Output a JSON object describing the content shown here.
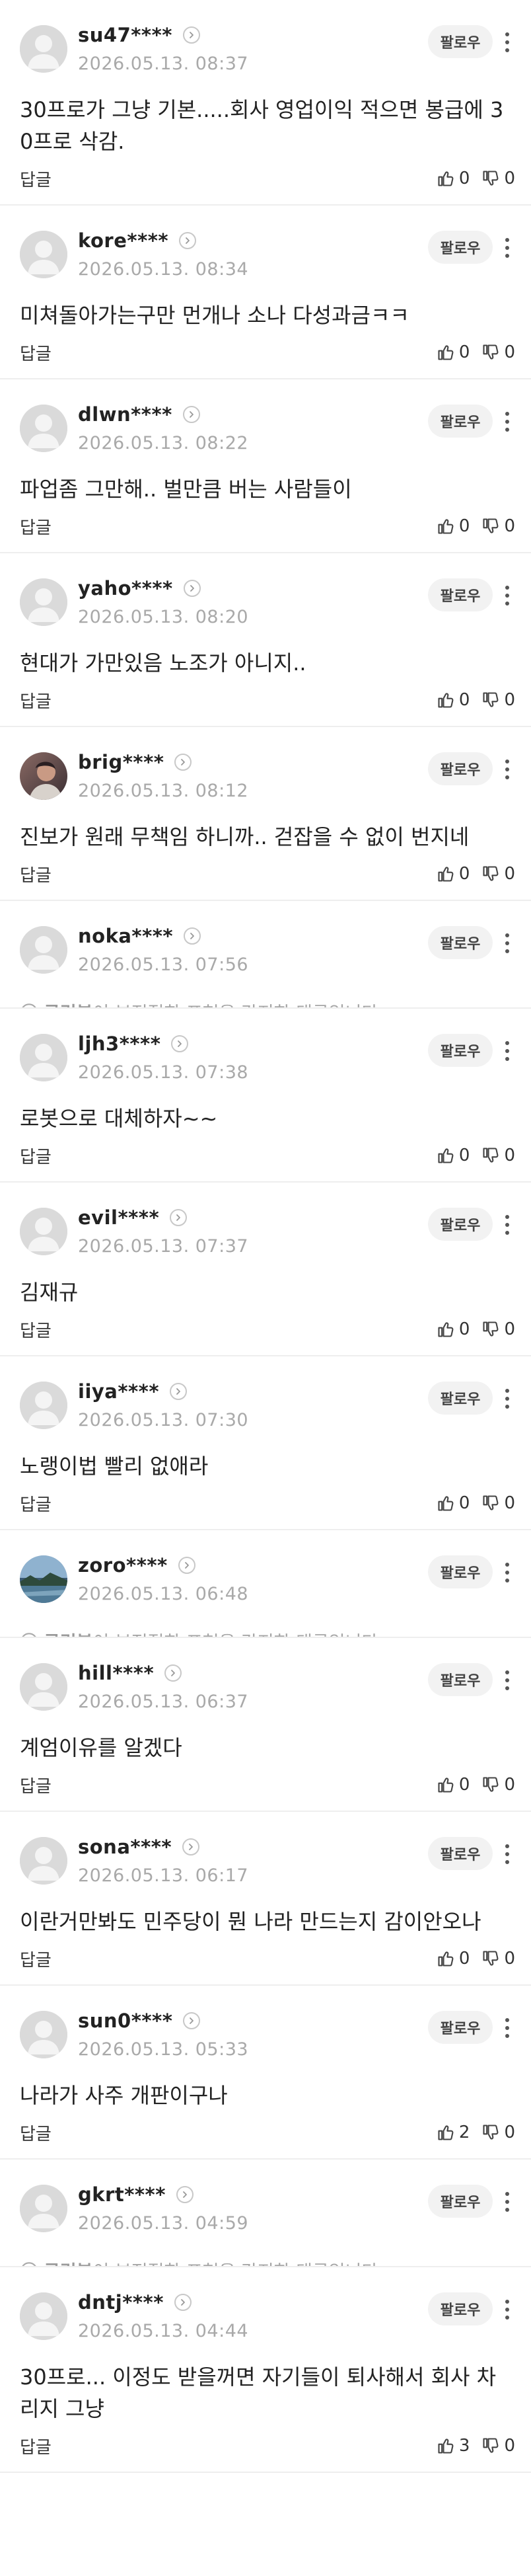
{
  "reply_label": "답글",
  "follow_label": "팔로우",
  "cleanbot": {
    "brand": "클린봇",
    "message": "이 부적절한 표현을 감지한 댓글입니다."
  },
  "comments": [
    {
      "nick": "su47****",
      "date": "2026.05.13. 08:37",
      "text": "30프로가 그냥 기본.....회사 영업이익 적으면 봉급에 30프로 삭감.",
      "lines": 2,
      "likes": "0",
      "dislikes": "0",
      "avatar": "default"
    },
    {
      "nick": "kore****",
      "date": "2026.05.13. 08:34",
      "text": "미쳐돌아가는구만 먼개나 소나 다성과금ㅋㅋ",
      "lines": 1,
      "likes": "0",
      "dislikes": "0",
      "avatar": "default"
    },
    {
      "nick": "dlwn****",
      "date": "2026.05.13. 08:22",
      "text": "파업좀 그만해.. 벌만큼 버는 사람들이",
      "lines": 1,
      "likes": "0",
      "dislikes": "0",
      "avatar": "default"
    },
    {
      "nick": "yaho****",
      "date": "2026.05.13. 08:20",
      "text": "현대가 가만있음 노조가 아니지..",
      "lines": 1,
      "likes": "0",
      "dislikes": "0",
      "avatar": "default"
    },
    {
      "nick": "brig****",
      "date": "2026.05.13. 08:12",
      "text": "진보가 원래 무책임 하니까.. 걷잡을 수 없이 번지네",
      "lines": 1,
      "likes": "0",
      "dislikes": "0",
      "avatar": "photo-person"
    },
    {
      "nick": "noka****",
      "date": "2026.05.13. 07:56",
      "filtered": true,
      "avatar": "default"
    },
    {
      "nick": "ljh3****",
      "date": "2026.05.13. 07:38",
      "text": "로봇으로 대체하자~~",
      "lines": 1,
      "likes": "0",
      "dislikes": "0",
      "avatar": "default"
    },
    {
      "nick": "evil****",
      "date": "2026.05.13. 07:37",
      "text": "김재규",
      "lines": 1,
      "likes": "0",
      "dislikes": "0",
      "avatar": "default"
    },
    {
      "nick": "iiya****",
      "date": "2026.05.13. 07:30",
      "text": "노랭이법 빨리 없애라",
      "lines": 1,
      "likes": "0",
      "dislikes": "0",
      "avatar": "default"
    },
    {
      "nick": "zoro****",
      "date": "2026.05.13. 06:48",
      "filtered": true,
      "avatar": "photo-landscape"
    },
    {
      "nick": "hill****",
      "date": "2026.05.13. 06:37",
      "text": "계엄이유를 알겠다",
      "lines": 1,
      "likes": "0",
      "dislikes": "0",
      "avatar": "default"
    },
    {
      "nick": "sona****",
      "date": "2026.05.13. 06:17",
      "text": "이란거만봐도 민주당이 뭔 나라 만드는지 감이안오나",
      "lines": 1,
      "likes": "0",
      "dislikes": "0",
      "avatar": "default"
    },
    {
      "nick": "sun0****",
      "date": "2026.05.13. 05:33",
      "text": "나라가 사주 개판이구나",
      "lines": 1,
      "likes": "2",
      "dislikes": "0",
      "avatar": "default"
    },
    {
      "nick": "gkrt****",
      "date": "2026.05.13. 04:59",
      "filtered": true,
      "avatar": "default"
    },
    {
      "nick": "dntj****",
      "date": "2026.05.13. 04:44",
      "text": "30프로... 이정도 받을꺼면 자기들이 퇴사해서 회사 차리지 그냥",
      "lines": 2,
      "likes": "3",
      "dislikes": "0",
      "avatar": "default"
    }
  ]
}
